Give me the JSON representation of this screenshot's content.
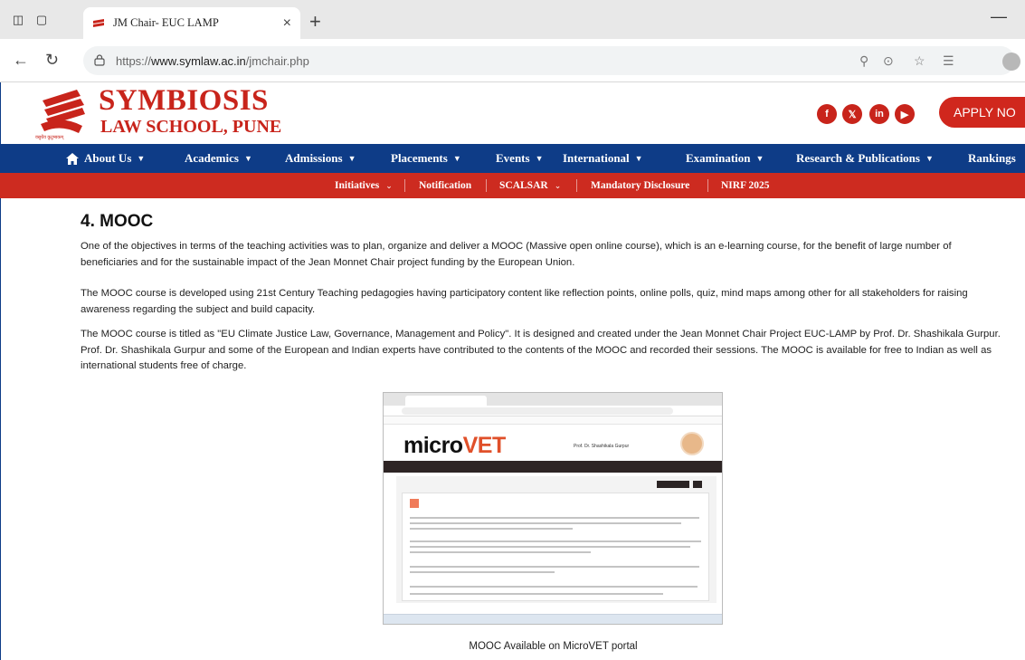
{
  "browser": {
    "tab_title": "JM Chair- EUC LAMP",
    "url_prefix": "https://",
    "url_host": "www.symlaw.ac.in",
    "url_path": "/jmchair.php"
  },
  "site": {
    "logo_title": "SYMBIOSIS",
    "logo_subtitle": "LAW SCHOOL, PUNE",
    "logo_tagline": "वसुधैव कुटुम्बकम्",
    "apply_label": "APPLY NO",
    "main_nav": [
      {
        "label": "About Us"
      },
      {
        "label": "Academics"
      },
      {
        "label": "Admissions"
      },
      {
        "label": "Placements"
      },
      {
        "label": "Events"
      },
      {
        "label": "International"
      },
      {
        "label": "Examination"
      },
      {
        "label": "Research & Publications"
      },
      {
        "label": "Rankings"
      }
    ],
    "sub_nav": [
      {
        "label": "Initiatives"
      },
      {
        "label": "Notification"
      },
      {
        "label": "SCALSAR"
      },
      {
        "label": "Mandatory Disclosure"
      },
      {
        "label": "NIRF 2025"
      }
    ]
  },
  "content": {
    "heading": "4. MOOC",
    "paragraphs": [
      "One of the objectives in terms of the teaching activities was to plan, organize and deliver a MOOC (Massive open online course), which is an e-learning course, for the benefit of large number of beneficiaries and for the sustainable impact of the Jean Monnet Chair project funding by the European Union.",
      "The MOOC course is developed using 21st Century Teaching pedagogies having participatory content like reflection points, online polls, quiz, mind maps among other for all stakeholders for raising awareness regarding the subject and build capacity.",
      "The MOOC course is titled as \"EU Climate Justice Law, Governance, Management and Policy\". It is designed and created under the Jean Monnet Chair Project EUC-LAMP by Prof. Dr. Shashikala Gurpur. Prof. Dr. Shashikala Gurpur and some of the European and Indian experts have contributed to the contents of the MOOC and recorded their sessions. The MOOC is available for free to Indian as well as international students free of charge."
    ],
    "screenshot": {
      "logo_a": "micro",
      "logo_b": "VET",
      "user": "Prof. Dr. Shashikala Gurpur"
    },
    "caption": "MOOC Available on MicroVET portal"
  },
  "colors": {
    "brand_red": "#c8241b",
    "nav_blue": "#0e3c87",
    "subnav_red": "#cd2b20"
  }
}
